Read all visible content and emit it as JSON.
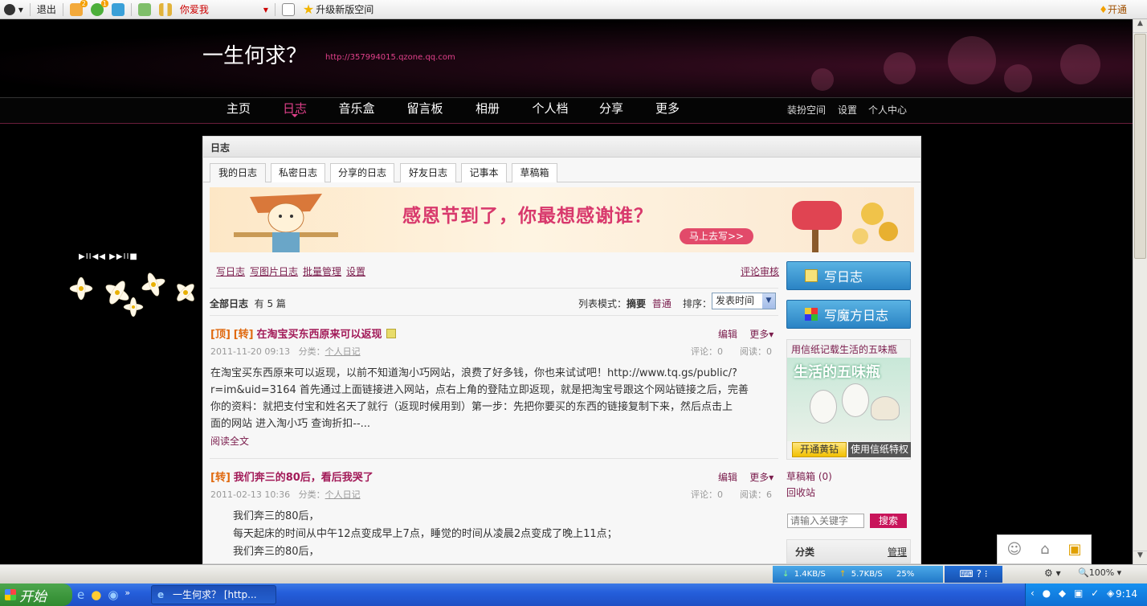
{
  "toolbar": {
    "logout": "退出",
    "badge1": "2",
    "badge2": "1",
    "name_label": "你爱我",
    "upgrade": "升级新版空间",
    "open": "开通"
  },
  "header": {
    "title": "一生何求？",
    "url": "http://357994015.qzone.qq.com"
  },
  "nav": {
    "items": [
      "主页",
      "日志",
      "音乐盒",
      "留言板",
      "相册",
      "个人档",
      "分享",
      "更多"
    ],
    "right": [
      "装扮空间",
      "设置",
      "个人中心"
    ]
  },
  "player": {
    "controls": "▶II◀◀ ▶▶II■"
  },
  "panel": {
    "heading": "日志",
    "tabs": [
      "我的日志",
      "私密日志",
      "分享的日志",
      "好友日志",
      "记事本",
      "草稿箱"
    ],
    "banner_text": "感恩节到了，你最想感谢谁？",
    "banner_button": "马上去写>>",
    "actions": [
      "写日志",
      "写图片日志",
      "批量管理",
      "设置"
    ],
    "review": "评论审核",
    "all_logs": "全部日志",
    "count": "有 5 篇",
    "list_mode_label": "列表模式：",
    "mode_summary": "摘要",
    "mode_normal": "普通",
    "sort_label": "排序：",
    "sort_value": "发表时间"
  },
  "posts": [
    {
      "tag1": "[顶]",
      "tag2": "[转]",
      "title": "在淘宝买东西原来可以返现",
      "edit": "编辑",
      "more": "更多▾",
      "date": "2011-11-20 09:13",
      "cat_label": "分类：",
      "category": "个人日记",
      "comments": "评论：0",
      "reads": "阅读：0",
      "lines": [
        "在淘宝买东西原来可以返现，以前不知道淘小巧网站，浪费了好多钱，你也来试试吧！http://www.tq.gs/public/?",
        "r=im&uid=3164 首先通过上面链接进入网站，点右上角的登陆立即返现，就是把淘宝号跟这个网站链接之后，完善",
        "你的资料：就把支付宝和姓名天了就行（返现时候用到）第一步：先把你要买的东西的链接复制下来，然后点击上",
        "面的网站 进入淘小巧 查询折扣--..."
      ],
      "read_more": "阅读全文"
    },
    {
      "tag2": "[转]",
      "title": "我们奔三的80后，看后我哭了",
      "edit": "编辑",
      "more": "更多▾",
      "date": "2011-02-13 10:36",
      "cat_label": "分类：",
      "category": "个人日记",
      "comments": "评论：0",
      "reads": "阅读：6",
      "lines": [
        "我们奔三的80后，",
        "每天起床的时间从中午12点变成早上7点，睡觉的时间从凌晨2点变成了晚上11点；",
        "我们奔三的80后，"
      ]
    }
  ],
  "sidebar": {
    "write_log": "写日志",
    "write_magic": "写魔方日志",
    "promo_title": "用信纸记载生活的五味瓶",
    "promo_image_text": "生活的五味瓶",
    "vip_button": "开通黄钻",
    "vip_text": "使用信纸特权",
    "drafts": "草稿箱 (0)",
    "recycle": "回收站",
    "search_placeholder": "请输入关键字",
    "search_button": "搜索",
    "category": "分类",
    "manage": "管理"
  },
  "statusbar": {
    "down": "1.4KB/S",
    "up": "5.7KB/S",
    "pct": "25%",
    "zoom": "100%"
  },
  "taskbar": {
    "start": "开始",
    "window": "一生何求？ [http...",
    "clock": "9:14"
  },
  "colors": {
    "accent": "#a21a58",
    "nav_active": "#e0408a",
    "button_blue": "#2a83c4"
  }
}
